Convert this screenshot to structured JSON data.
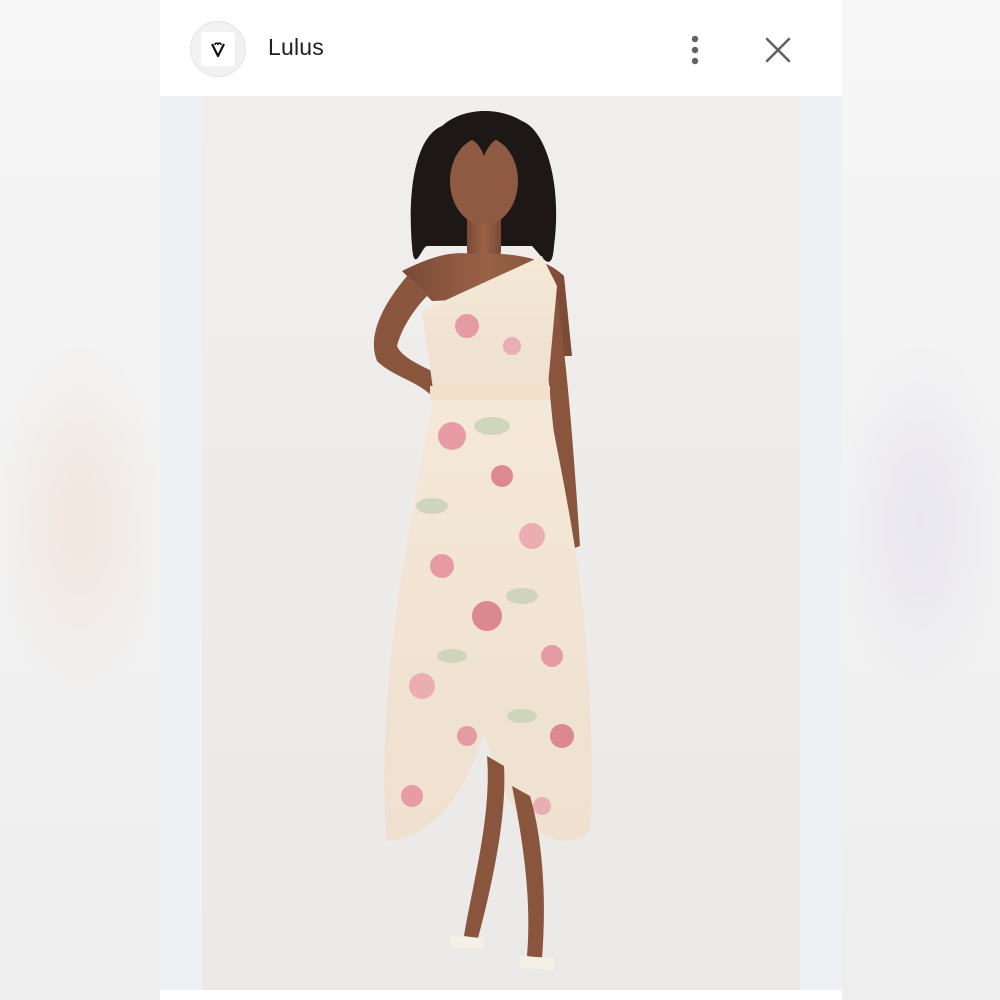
{
  "header": {
    "brand_name": "Lulus",
    "brand_logo_icon": "heart-v-logo-icon",
    "more_icon": "more-vertical-icon",
    "close_icon": "close-icon"
  },
  "image": {
    "subject": "product-photo",
    "dress_print_colors": [
      "#f3e6d2",
      "#e58e9c",
      "#c9d3b8",
      "#f2c9b8"
    ]
  }
}
